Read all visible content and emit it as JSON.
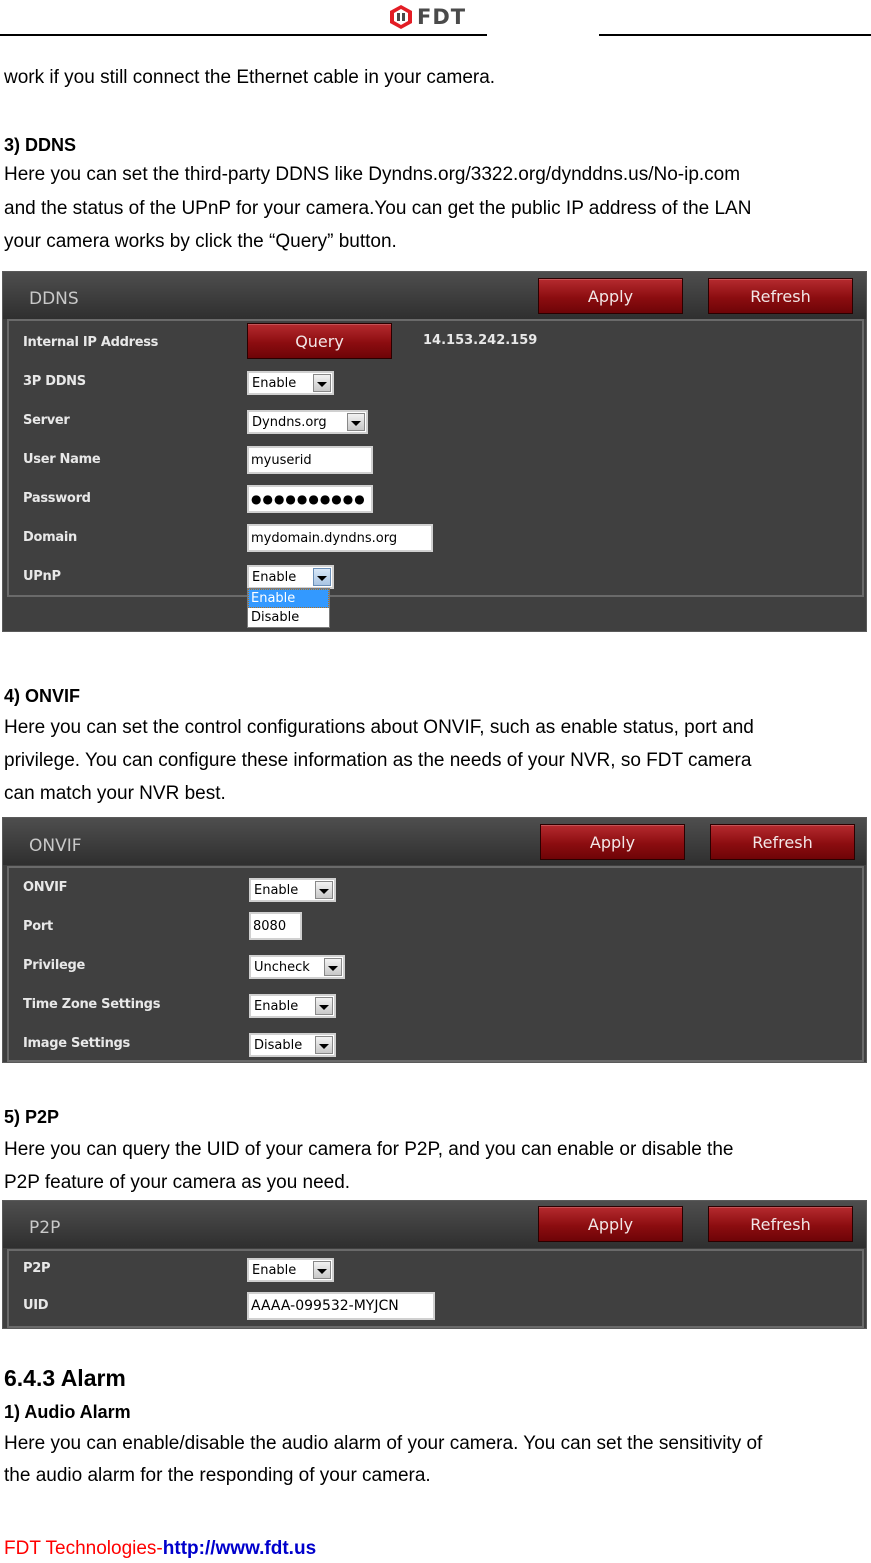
{
  "header": {
    "logo_text": "FDT",
    "logo_color": "#e31d25"
  },
  "intro": {
    "line1": "work if you still connect the Ethernet cable in your camera."
  },
  "ddns_section": {
    "heading": "3) DDNS",
    "lines": [
      "Here you can set the third-party DDNS like Dyndns.org/3322.org/dynddns.us/No-ip.com",
      "and the status of the UPnP for your camera.You can get the public IP address of the LAN",
      "your camera works by click the “Query” button."
    ],
    "panel": {
      "title": "DDNS",
      "apply_label": "Apply",
      "refresh_label": "Refresh",
      "rows": {
        "internal_ip": {
          "label": "Internal IP Address",
          "button": "Query",
          "value": "14.153.242.159"
        },
        "ddns3p": {
          "label": "3P DDNS",
          "value": "Enable"
        },
        "server": {
          "label": "Server",
          "value": "Dyndns.org"
        },
        "username": {
          "label": "User Name",
          "value": "myuserid"
        },
        "password": {
          "label": "Password",
          "value": "●●●●●●●●●●"
        },
        "domain": {
          "label": "Domain",
          "value": "mydomain.dyndns.org"
        },
        "upnp": {
          "label": "UPnP",
          "value": "Enable",
          "options": [
            "Enable",
            "Disable"
          ],
          "highlighted": "Enable"
        }
      }
    }
  },
  "onvif_section": {
    "heading": "4) ONVIF",
    "lines": [
      "Here you can set the control configurations about ONVIF, such as enable status, port and",
      "privilege. You can configure these information as the needs of your NVR, so FDT camera",
      "can match your NVR best."
    ],
    "panel": {
      "title": "ONVIF",
      "apply_label": "Apply",
      "refresh_label": "Refresh",
      "rows": {
        "onvif": {
          "label": "ONVIF",
          "value": "Enable"
        },
        "port": {
          "label": "Port",
          "value": "8080"
        },
        "privilege": {
          "label": "Privilege",
          "value": "Uncheck"
        },
        "timezone": {
          "label": "Time Zone Settings",
          "value": "Enable"
        },
        "image": {
          "label": "Image Settings",
          "value": "Disable"
        }
      }
    }
  },
  "p2p_section": {
    "heading": "5) P2P",
    "lines": [
      "Here you can query the UID of your camera for P2P, and you can enable or disable the",
      "P2P feature of your camera as you need."
    ],
    "panel": {
      "title": "P2P",
      "apply_label": "Apply",
      "refresh_label": "Refresh",
      "rows": {
        "p2p": {
          "label": "P2P",
          "value": "Enable"
        },
        "uid": {
          "label": "UID",
          "value": "AAAA-099532-MYJCN"
        }
      }
    }
  },
  "alarm_section": {
    "heading": "6.4.3 Alarm",
    "subheading": "1) Audio Alarm",
    "lines": [
      "Here you can enable/disable the audio alarm of your camera. You can set the sensitivity of",
      "the audio alarm for the responding of your camera."
    ]
  },
  "footer": {
    "company": "FDT Technologies-",
    "url": "http://www.fdt.us",
    "company_color": "#ff0000",
    "url_color": "#0000cc"
  }
}
